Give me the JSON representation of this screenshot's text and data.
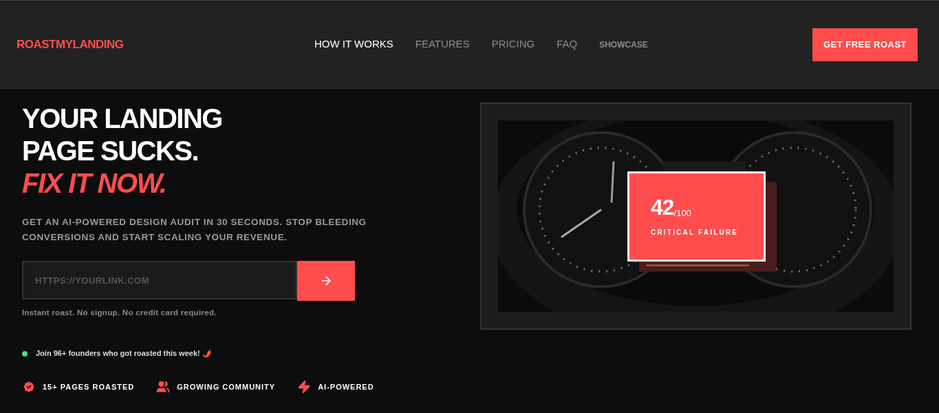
{
  "header": {
    "logo": "ROASTMYLANDING",
    "nav": [
      {
        "label": "HOW IT WORKS",
        "selected": true,
        "kind": "link"
      },
      {
        "label": "FEATURES",
        "selected": false,
        "kind": "link"
      },
      {
        "label": "PRICING",
        "selected": false,
        "kind": "link"
      },
      {
        "label": "FAQ",
        "selected": false,
        "kind": "link"
      },
      {
        "label": "SHOWCASE",
        "selected": false,
        "kind": "compact"
      }
    ],
    "cta": "GET FREE ROAST"
  },
  "hero": {
    "title_lines": [
      "YOUR LANDING",
      "PAGE SUCKS."
    ],
    "title_accent": "FIX IT NOW.",
    "subtitle": "GET AN AI-POWERED DESIGN AUDIT IN 30 SECONDS. STOP BLEEDING CONVERSIONS AND START SCALING YOUR REVENUE.",
    "url_field": {
      "placeholder": "HTTPS://YOURLINK.COM"
    },
    "note": "Instant roast. No signup. No credit card required.",
    "social_proof": {
      "text": "Join 96+ founders who got roasted this week! 🌶️",
      "color": "#4ade80"
    },
    "features": [
      {
        "kind": "badge",
        "label": "15+ PAGES ROASTED"
      },
      {
        "kind": "community",
        "label": "GROWING COMMUNITY"
      },
      {
        "kind": "bolt",
        "label": "AI-POWERED"
      }
    ]
  },
  "preview": {
    "score": {
      "value": "42",
      "max": "/100",
      "label": "CRITICAL FAILURE"
    }
  }
}
